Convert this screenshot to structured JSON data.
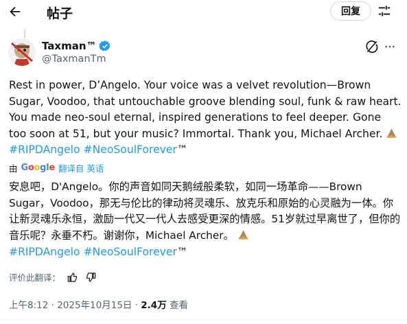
{
  "header": {
    "title": "帖子",
    "reply_label": "回复"
  },
  "author": {
    "name": "Taxman™",
    "handle": "@TaxmanTm"
  },
  "post": {
    "text_en": "Rest in power, D’Angelo. Your voice was a velvet revolution—Brown Sugar, Voodoo, that untouchable groove blending soul, funk & raw heart. You made neo-soul eternal, inspired generations to feel deeper. Gone too soon at 51, but your music? Immortal. Thank you, Michael Archer.",
    "hashtag1": "#RIPDAngelo",
    "hashtag2": "#NeoSoulForever",
    "tm": "™",
    "text_zh": "安息吧，D'Angelo。你的声音如同天鹅绒般柔软，如同一场革命——Brown Sugar，Voodoo，那无与伦比的律动将灵魂乐、放克乐和原始的心灵融为一体。你让新灵魂乐永恒，激励一代又一代人去感受更深的情感。51岁就过早离世了，但你的音乐呢？永垂不朽。谢谢你，Michael Archer。"
  },
  "translation": {
    "by": "由",
    "google": [
      "G",
      "o",
      "o",
      "g",
      "l",
      "e"
    ],
    "translated_from": "翻译自 英语"
  },
  "rating": {
    "label": "评价此翻译："
  },
  "meta": {
    "time": "上午8:12 · 2025年10月15日 · ",
    "views": "2.4万",
    "views_label": " 查看"
  },
  "icons": [
    "back-arrow-icon",
    "settings-sliders-icon",
    "verified-badge-icon",
    "grok-icon",
    "more-icon",
    "prayer-emoji-icon",
    "thumbs-up-icon",
    "thumbs-down-icon"
  ]
}
